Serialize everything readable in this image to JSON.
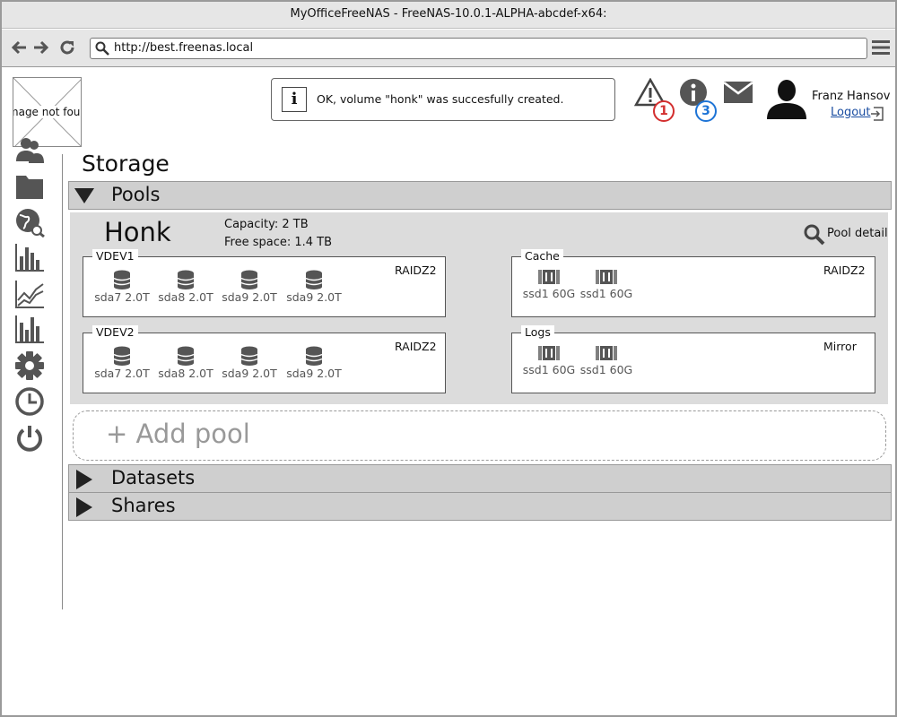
{
  "window": {
    "title": "MyOfficeFreeNAS - FreeNAS-10.0.1-ALPHA-abcdef-x64:"
  },
  "browser": {
    "url": "http://best.freenas.local"
  },
  "logo": {
    "placeholder_text": "Image not found"
  },
  "sidebar": {
    "icons": [
      "users-icon",
      "folder-icon",
      "globe-network-icon",
      "bar-chart-icon",
      "line-chart-icon",
      "bar-chart-alt-icon",
      "gear-icon",
      "clock-icon",
      "power-icon"
    ]
  },
  "notification": {
    "message": "OK, volume \"honk\" was succesfully created."
  },
  "header": {
    "alerts_count": "1",
    "info_count": "3",
    "alerts_color": "#d32f2f",
    "info_color": "#1e74d6",
    "user_name": "Franz Hansov",
    "logout_label": "Logout"
  },
  "page": {
    "title": "Storage"
  },
  "sections": {
    "pools": "Pools",
    "datasets": "Datasets",
    "shares": "Shares"
  },
  "pool": {
    "name": "Honk",
    "capacity": "Capacity: 2 TB",
    "free_space": "Free space: 1.4 TB",
    "detail_label": "Pool detail",
    "vdevs": [
      {
        "title": "VDEV1",
        "type": "RAIDZ2",
        "disks": [
          "sda7 2.0T",
          "sda8 2.0T",
          "sda9 2.0T",
          "sda9 2.0T"
        ]
      },
      {
        "title": "VDEV2",
        "type": "RAIDZ2",
        "disks": [
          "sda7 2.0T",
          "sda8 2.0T",
          "sda9 2.0T",
          "sda9 2.0T"
        ]
      }
    ],
    "cache": {
      "title": "Cache",
      "type": "RAIDZ2",
      "disks": [
        "ssd1 60G",
        "ssd1 60G"
      ]
    },
    "logs": {
      "title": "Logs",
      "type": "Mirror",
      "disks": [
        "ssd1 60G",
        "ssd1 60G"
      ]
    }
  },
  "add_pool": {
    "label": "+ Add pool"
  }
}
